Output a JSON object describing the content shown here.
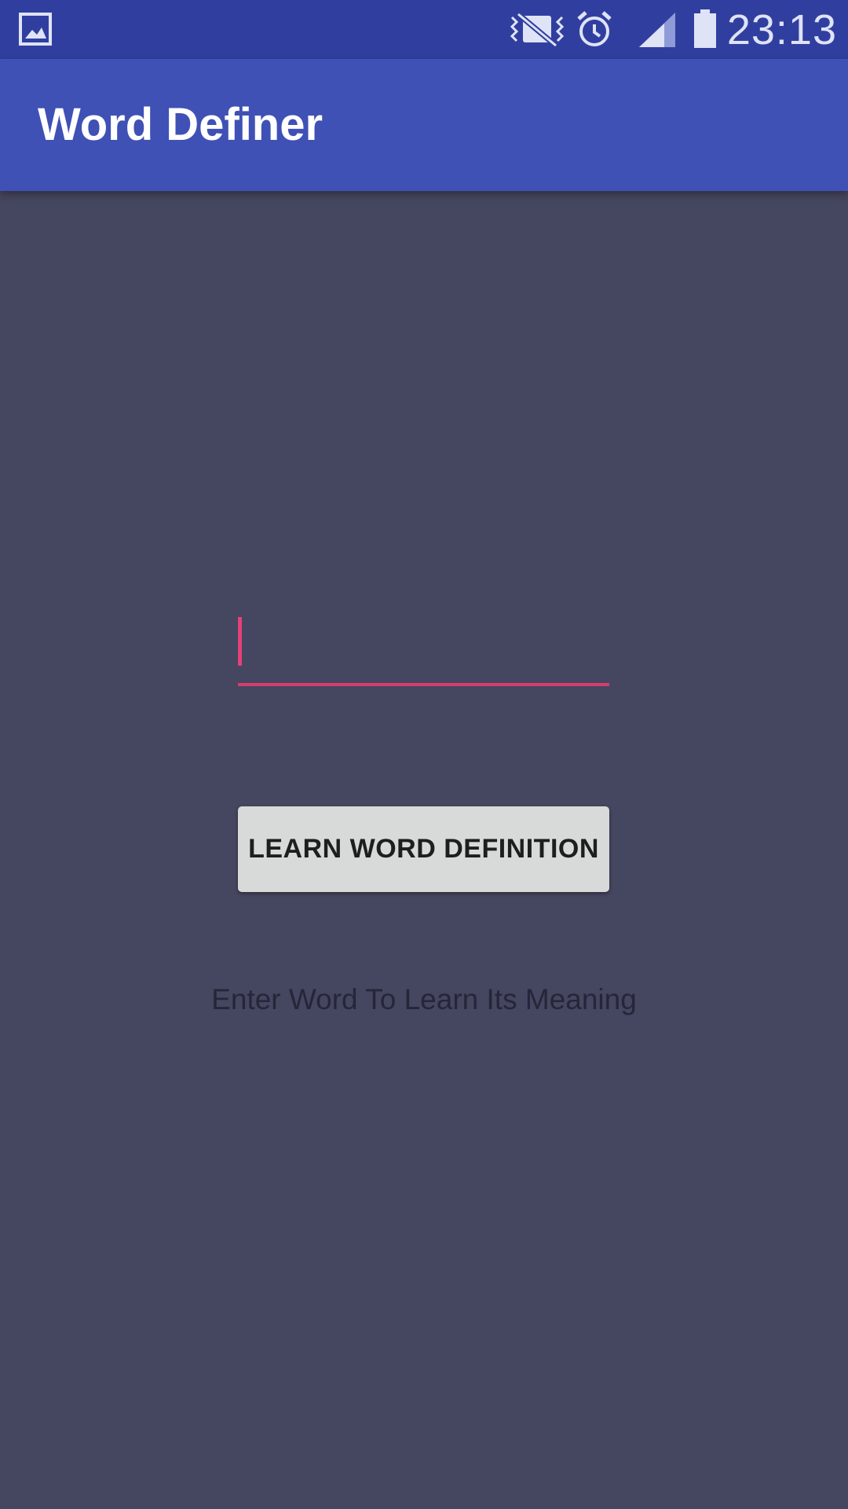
{
  "status_bar": {
    "time": "23:13",
    "icons": [
      "gallery-icon",
      "vibrate-off-icon",
      "alarm-icon",
      "signal-icon",
      "battery-icon"
    ],
    "colors": {
      "background": "#303f9f",
      "icon": "#dfe3f6"
    }
  },
  "app_bar": {
    "title": "Word Definer",
    "color": "#3f51b5"
  },
  "main": {
    "word_input": {
      "value": "",
      "placeholder": ""
    },
    "learn_button_label": "LEARN WORD DEFINITION",
    "hint": "Enter Word To Learn Its Meaning",
    "colors": {
      "background": "#45465f",
      "accent": "#e4407a"
    }
  }
}
